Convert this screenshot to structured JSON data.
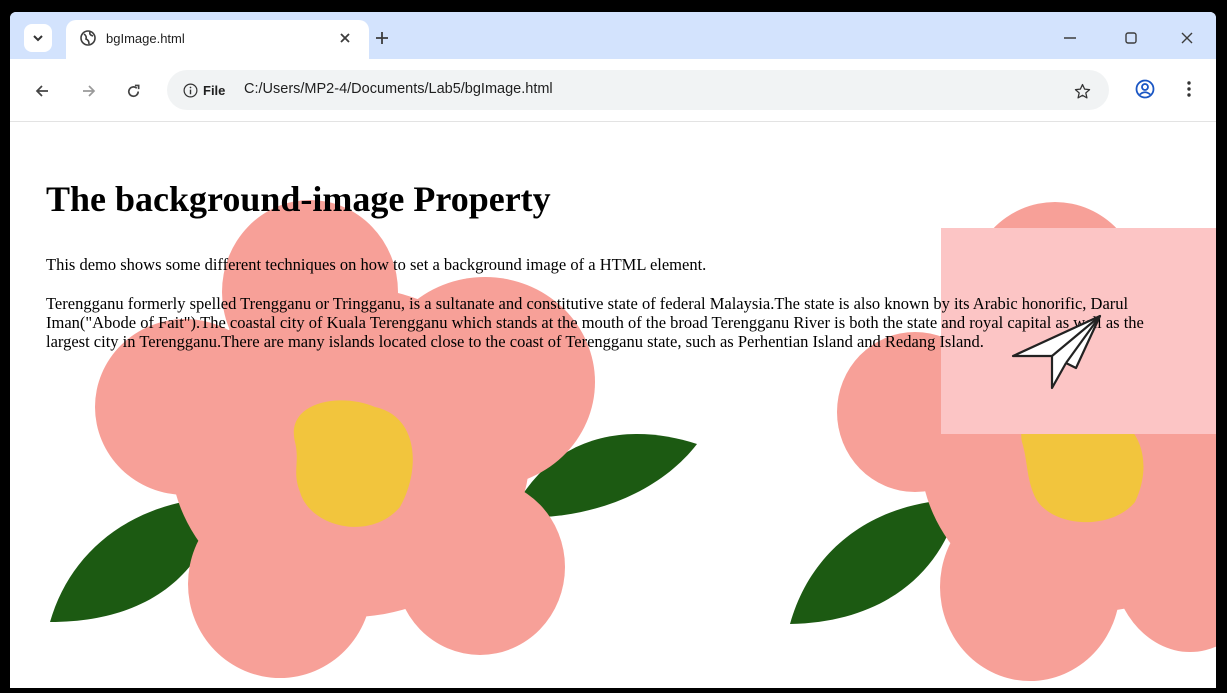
{
  "browser": {
    "tab": {
      "title": "bgImage.html"
    },
    "address": {
      "site_chip": "File",
      "url": "C:/Users/MP2-4/Documents/Lab5/bgImage.html"
    }
  },
  "page": {
    "heading": "The background-image Property",
    "intro": "This demo shows some different techniques on how to set a background image of a HTML element.",
    "paragraph": "Terengganu formerly spelled Trengganu or Tringganu, is a sultanate and constitutive state of federal Malaysia.The state is also known by its Arabic honorific, Darul Iman(\"Abode of Fait\").The coastal city of Kuala Terengganu which stands at the mouth of the broad Terengganu River is both the state and royal capital as well as the largest city in Terengganu.There are many islands located close to the coast of Terengganu state, such as Perhentian Island and Redang Island."
  },
  "colors": {
    "tabstrip": "#d3e3fd",
    "flower_petal": "#f7a098",
    "flower_center": "#f2c53d",
    "leaf": "#1c5a12",
    "pink_box": "#fcc5c5"
  },
  "icons": [
    "tab-search-icon",
    "globe-icon",
    "close-icon",
    "plus-icon",
    "minimize-icon",
    "maximize-icon",
    "window-close-icon",
    "back-arrow-icon",
    "forward-arrow-icon",
    "reload-icon",
    "info-icon",
    "star-icon",
    "profile-icon",
    "kebab-menu-icon",
    "paper-plane-icon"
  ]
}
